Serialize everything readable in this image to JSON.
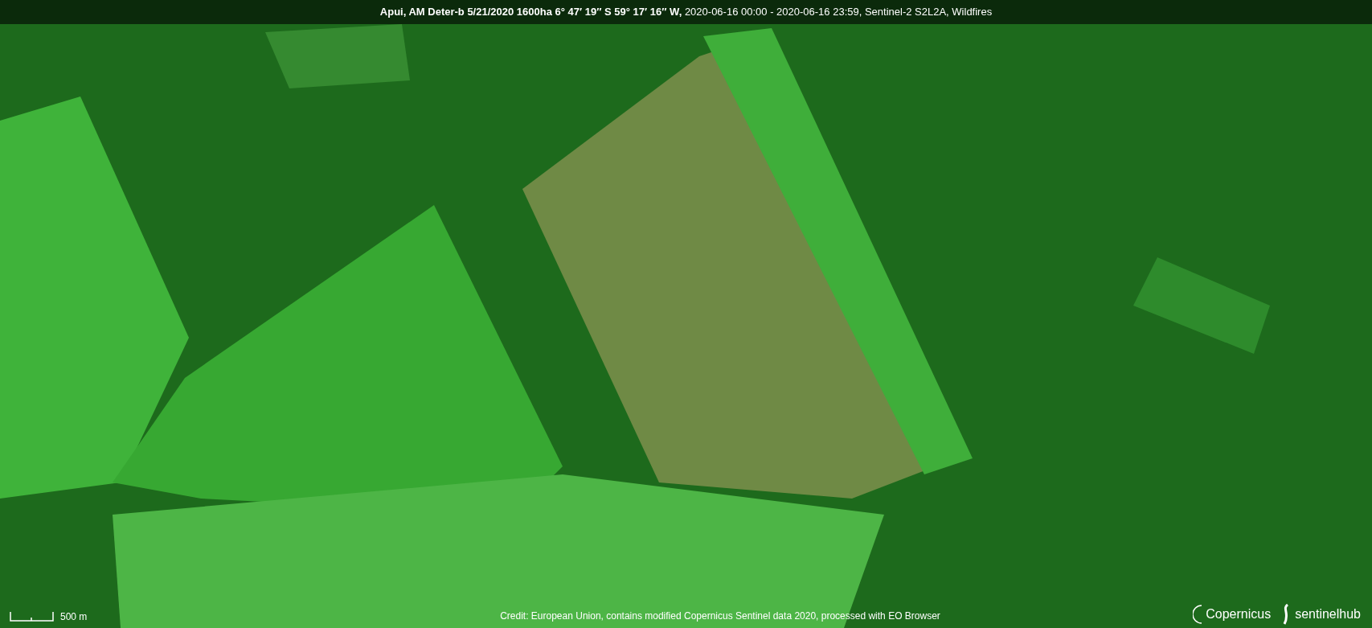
{
  "title_bar": {
    "title": "**Apui, AM Deter-b 5/21/2020 1600ha 6° 47′ 19″ S 59° 17′ 16″ W,** 2020-06-16 00:00 - 2020-06-16 23:59, Sentinel-2 S2L2A, Wildfires"
  },
  "scale_bar": {
    "label": "500 m"
  },
  "credit": "Credit: European Union, contains modified Copernicus Sentinel data 2020, processed with EO Browser",
  "logos": [
    {
      "kind": "copernicus",
      "label": "Copernicus"
    },
    {
      "kind": "sentinelhub",
      "label": "sentinelhub"
    }
  ]
}
